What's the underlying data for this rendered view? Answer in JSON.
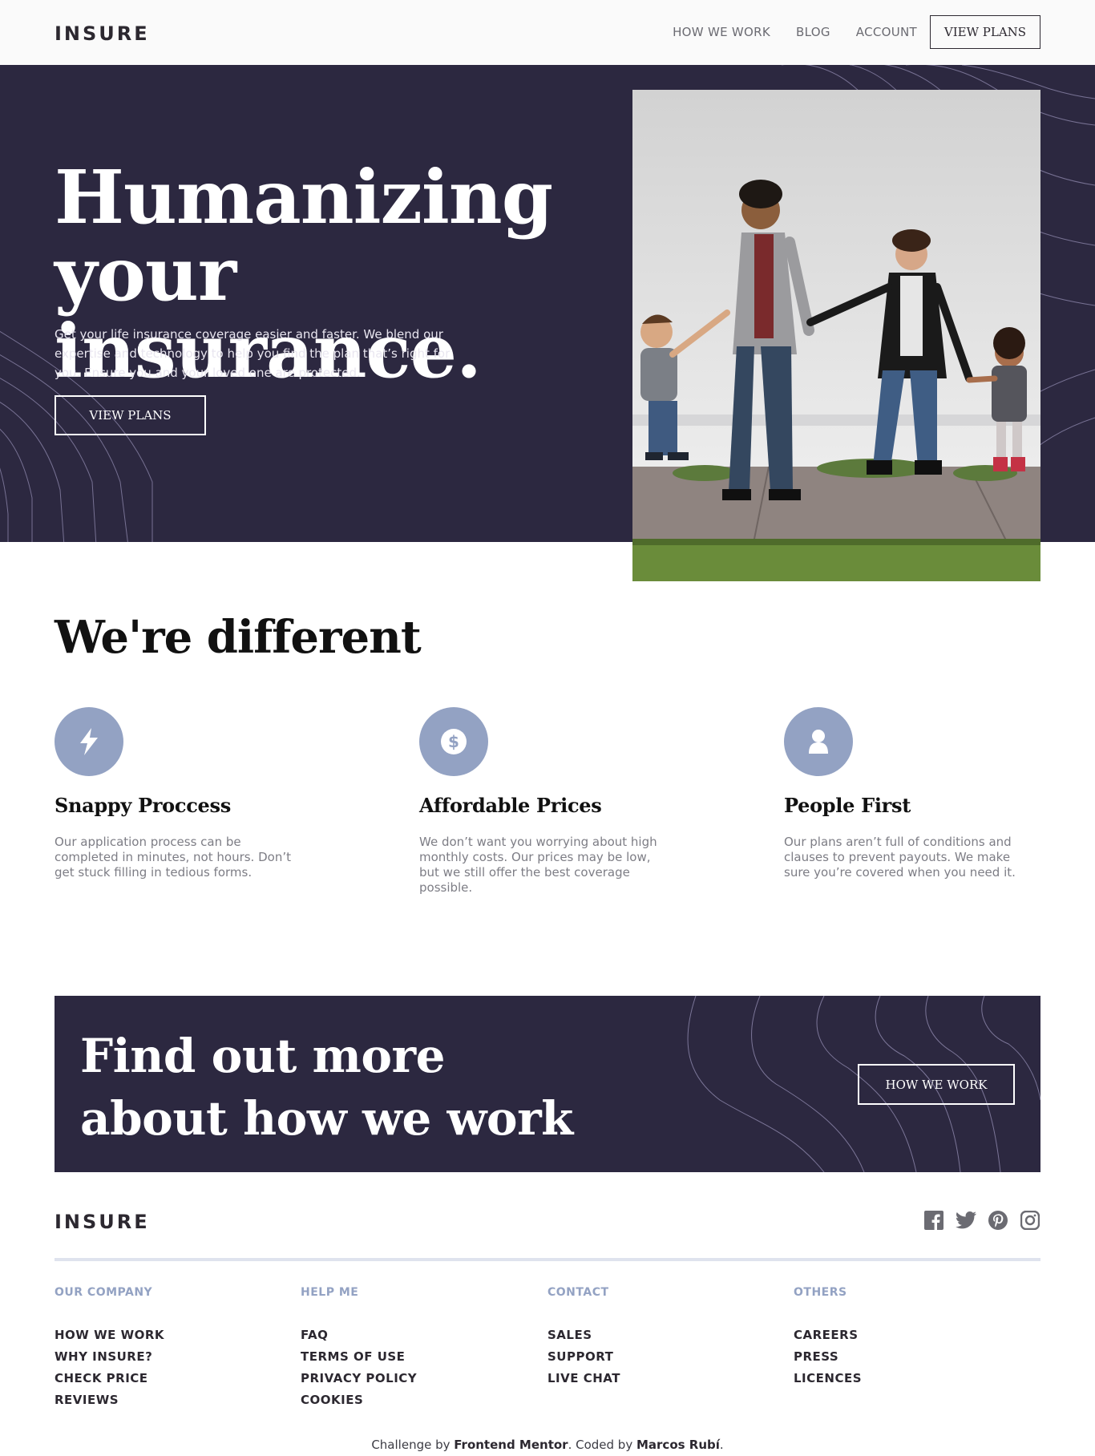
{
  "nav": {
    "logo": "INSURE",
    "links": [
      "HOW WE WORK",
      "BLOG",
      "ACCOUNT"
    ],
    "cta": "VIEW PLANS"
  },
  "hero": {
    "title_line1": "Humanizing",
    "title_line2": "your insurance.",
    "text": "Get your life insurance coverage easier and faster. We blend our expertise and technology to help you find the plan that’s right for you. Ensure you and your loved one are protected.",
    "button": "VIEW PLANS"
  },
  "different": {
    "title": "We're different",
    "features": [
      {
        "icon": "lightning-icon",
        "title": "Snappy Proccess",
        "text": "Our application process can be completed in minutes, not hours. Don’t get stuck filling in tedious forms."
      },
      {
        "icon": "dollar-coin-icon",
        "title": "Affordable Prices",
        "text": "We don’t want you worrying about high monthly costs. Our prices may be low, but we still offer the best coverage possible."
      },
      {
        "icon": "person-icon",
        "title": "People First",
        "text": "Our plans aren’t full of conditions and clauses to prevent payouts. We make sure you’re covered when you need it."
      }
    ]
  },
  "cta": {
    "title_line1": "Find out more",
    "title_line2": "about how we work",
    "button": "HOW WE WORK"
  },
  "footer": {
    "logo": "INSURE",
    "social": [
      "facebook-icon",
      "twitter-icon",
      "pinterest-icon",
      "instagram-icon"
    ],
    "columns": [
      {
        "heading": "OUR COMPANY",
        "items": [
          "HOW WE WORK",
          "WHY INSURE?",
          "CHECK PRICE",
          "REVIEWS"
        ]
      },
      {
        "heading": "HELP ME",
        "items": [
          "FAQ",
          "TERMS OF USE",
          "PRIVACY POLICY",
          "COOKIES"
        ]
      },
      {
        "heading": "CONTACT",
        "items": [
          "SALES",
          "SUPPORT",
          "LIVE CHAT"
        ]
      },
      {
        "heading": "OTHERS",
        "items": [
          "CAREERS",
          "PRESS",
          "LICENCES"
        ]
      }
    ],
    "credit_prefix": "Challenge by ",
    "credit_fm": "Frontend Mentor",
    "credit_mid": ". Coded by ",
    "credit_author": "Marcos Rubí",
    "credit_suffix": "."
  },
  "colors": {
    "dark_violet": "#2c2840",
    "grayish_blue": "#93a2c3",
    "light_bg": "#fafafa"
  }
}
